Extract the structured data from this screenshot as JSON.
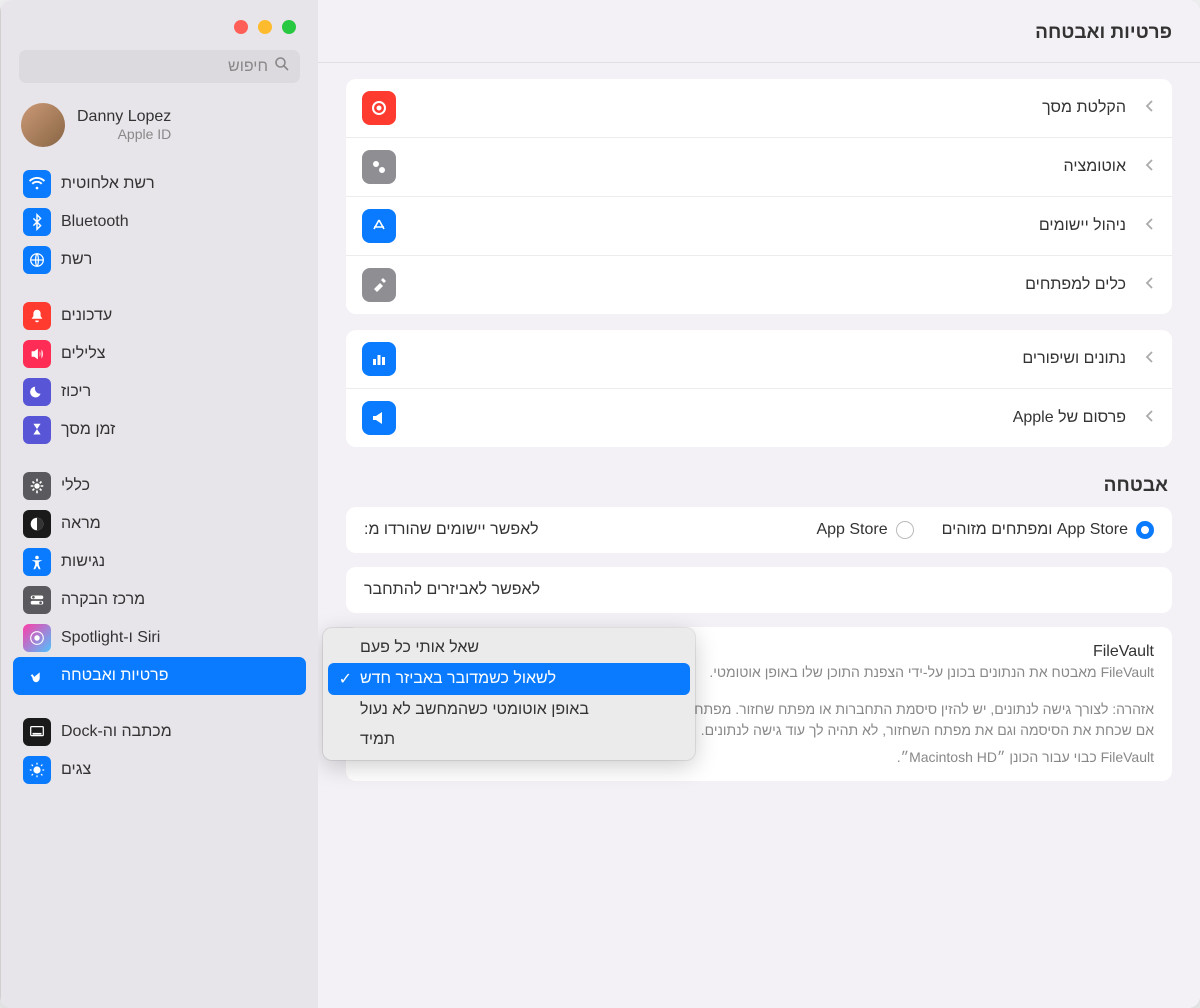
{
  "header": {
    "title": "פרטיות ואבטחה"
  },
  "search": {
    "placeholder": "חיפוש"
  },
  "account": {
    "name": "Danny Lopez",
    "sub": "Apple ID"
  },
  "sidebar": {
    "g1": [
      {
        "label": "רשת אלחוטית",
        "icon": "wifi",
        "color": "ic-blue"
      },
      {
        "label": "Bluetooth",
        "icon": "bluetooth",
        "color": "ic-blue"
      },
      {
        "label": "רשת",
        "icon": "globe",
        "color": "ic-blue"
      }
    ],
    "g2": [
      {
        "label": "עדכונים",
        "icon": "bell",
        "color": "ic-red"
      },
      {
        "label": "צלילים",
        "icon": "speaker",
        "color": "ic-pink"
      },
      {
        "label": "ריכוז",
        "icon": "moon",
        "color": "ic-purple"
      },
      {
        "label": "זמן מסך",
        "icon": "hourglass",
        "color": "ic-purple"
      }
    ],
    "g3": [
      {
        "label": "כללי",
        "icon": "gear",
        "color": "ic-darkgray"
      },
      {
        "label": "מראה",
        "icon": "contrast",
        "color": "ic-black"
      },
      {
        "label": "נגישות",
        "icon": "accessibility",
        "color": "ic-blue"
      },
      {
        "label": "מרכז הבקרה",
        "icon": "switches",
        "color": "ic-darkgray"
      },
      {
        "label": "Siri ו-Spotlight",
        "icon": "siri",
        "color": "ic-siri"
      },
      {
        "label": "פרטיות ואבטחה",
        "icon": "hand",
        "color": "ic-blue",
        "selected": true
      }
    ],
    "g4": [
      {
        "label": "מכתבה וה-Dock",
        "icon": "dock",
        "color": "ic-black"
      },
      {
        "label": "צגים",
        "icon": "brightness",
        "color": "ic-blue"
      }
    ]
  },
  "privacy_rows_a": [
    {
      "label": "הקלטת מסך",
      "icon": "record",
      "color": "ic-record"
    },
    {
      "label": "אוטומציה",
      "icon": "gears",
      "color": "ic-gray"
    },
    {
      "label": "ניהול יישומים",
      "icon": "appstore",
      "color": "ic-blue"
    },
    {
      "label": "כלים למפתחים",
      "icon": "hammer",
      "color": "ic-gray"
    }
  ],
  "privacy_rows_b": [
    {
      "label": "נתונים ושיפורים",
      "icon": "chart",
      "color": "ic-blue"
    },
    {
      "label": "פרסום של Apple",
      "icon": "megaphone",
      "color": "ic-blue"
    }
  ],
  "security": {
    "title": "אבטחה",
    "allow_apps_label": "לאפשר יישומים שהורדו מ:",
    "radio_a": "App Store",
    "radio_b": "App Store ומפתחים מזוהים",
    "accessories_label": "לאפשר לאביזרים להתחבר",
    "filevault": {
      "title": "FileVault",
      "desc": "FileVault מאבטח את הנתונים בכונן על-ידי הצפנת התוכן שלו באופן אוטומטי.",
      "warning": "אזהרה: לצורך גישה לנתונים, יש להזין סיסמת התחברות או מפתח שחזור. מפתח שחזור נוצר באופן אוטומטי כחלק מתהליך ההגדרה הזה. אם שכחת את הסיסמה וגם את מפתח השחזור, לא תהיה לך עוד גישה לנתונים.",
      "status": "FileVault כבוי עבור הכונן ״Macintosh HD״."
    }
  },
  "dropdown": {
    "opt1": "שאל אותי כל פעם",
    "opt2": "לשאול כשמדובר באביזר חדש",
    "opt3": "באופן אוטומטי כשהמחשב לא נעול",
    "opt4": "תמיד"
  }
}
